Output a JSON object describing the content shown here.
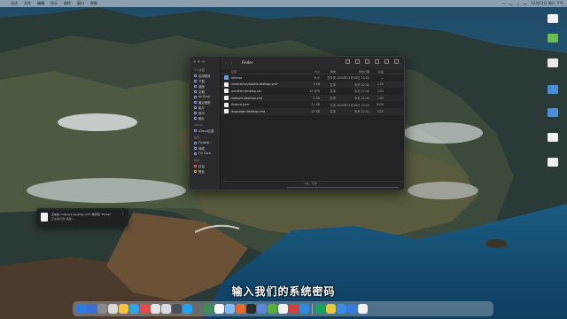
{
  "menubar": {
    "apple": "",
    "items": [
      "访达",
      "文件",
      "编辑",
      "显示",
      "前往",
      "窗口",
      "帮助"
    ],
    "datetime": "12月11日 周六 下午"
  },
  "finder": {
    "title": "Finder",
    "nav": "‹ ›",
    "sidebar": {
      "sections": [
        "个人收藏",
        "iCloud",
        "位置",
        "标签"
      ],
      "items": [
        "应用程序",
        "下载",
        "桌面",
        "文稿",
        "AirDrop",
        "最近使用",
        "影片",
        "音乐",
        "图片",
        "iCloud云盘",
        "Flydeal…",
        "网络",
        "Fly Core",
        "红色",
        "橙色"
      ]
    },
    "columns": {
      "name": "名称",
      "size": "大小",
      "kind": "种类",
      "date": "修改日期",
      "tag": "标签"
    },
    "rows": [
      {
        "name": "Alfonse",
        "size": "大小",
        "kind": "文件夹",
        "date": "2020年11月18日 10:03",
        "tag": "—",
        "color": "#5aa0ea"
      },
      {
        "name": "vmdirectorytoolkit.desktop.vmt",
        "size": "3 KB",
        "kind": "文本",
        "date": "今天 22:41",
        "tag": "CSV",
        "color": "#f0f0f0"
      },
      {
        "name": "parallels.desktop.txt",
        "size": "12 字节",
        "kind": "文本",
        "date": "今天 22:41",
        "tag": "CSV",
        "color": "#f0f0f0"
      },
      {
        "name": "network.desktop.vmt",
        "size": "3 KB",
        "kind": "文本",
        "date": "今天 22:41",
        "tag": "CSV",
        "color": "#f0f0f0"
      },
      {
        "name": "finance.json",
        "size": "11 KB",
        "kind": "文本",
        "date": "2020年11月18日 10:03",
        "tag": "JSON",
        "color": "#f0f0f0"
      },
      {
        "name": "dropdown.desktop.vmt",
        "size": "15 KB",
        "kind": "文本",
        "date": "今天 22:41",
        "tag": "CSV",
        "color": "#f0f0f0"
      }
    ],
    "status": "6项，可用 …"
  },
  "notification": {
    "title": "正在将 \"network.desktop.vmt\" 拷贝到 \"Finder\"",
    "body": "正在拷贝到“桌面”…",
    "close": "×"
  },
  "caption": "输入我们的系统密码",
  "desktop_icons": [
    {
      "label": "",
      "color": "#f0f0f0"
    },
    {
      "label": "",
      "color": "#6bbf4e"
    },
    {
      "label": "",
      "color": "#e8e8e8"
    },
    {
      "label": "",
      "color": "#4a90d9"
    },
    {
      "label": "",
      "color": "#4a90d9"
    },
    {
      "label": "",
      "color": "#f0f0f0"
    },
    {
      "label": "",
      "color": "#f0f0f0"
    }
  ],
  "dock_colors": [
    "#2b7be4",
    "#3a6fd8",
    "#8a8a8a",
    "#d9d9d9",
    "#f3c33b",
    "#2ea4e8",
    "#e84a4a",
    "#e4e4e4",
    "#d8dbe0",
    "#4a4f5a",
    "#1fa3f2",
    "#6a6a6a",
    "#3d8d5a",
    "#f7f7f7",
    "#7fbcf5",
    "#e86a2e",
    "#2c2c2c",
    "#5a87d8",
    "#58b038",
    "#f0f0f0",
    "#d04040",
    "#2f8ae0",
    "#1aa261",
    "#e8c73b",
    "#3a8ae8",
    "#3a77e0",
    "#f2f2f2"
  ]
}
